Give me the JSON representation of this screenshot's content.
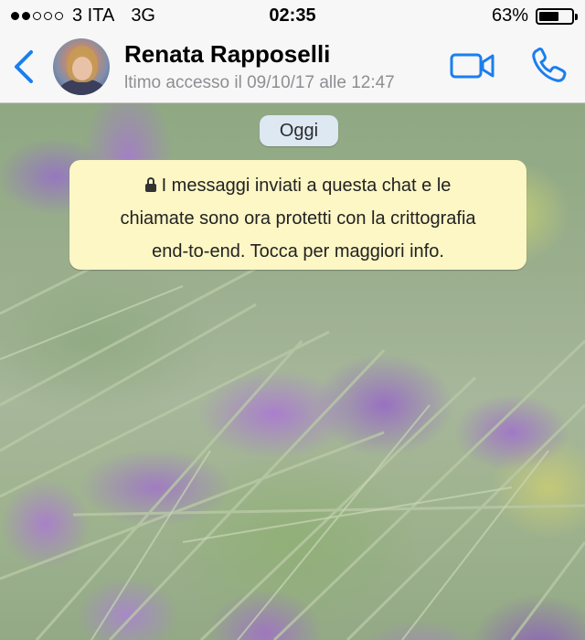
{
  "status_bar": {
    "carrier": "3 ITA",
    "network": "3G",
    "time": "02:35",
    "battery_percent_label": "63%",
    "battery_level": 0.63,
    "signal_bars_filled": 2,
    "signal_bars_total": 5
  },
  "header": {
    "back_icon": "chevron-left-icon",
    "contact_name": "Renata Rapposelli",
    "last_seen": "ltimo accesso il 09/10/17 alle 12:47",
    "video_icon": "video-camera-icon",
    "call_icon": "phone-icon",
    "accent_color": "#1a7ef0"
  },
  "chat": {
    "date_label": "Oggi",
    "encryption_notice": {
      "icon": "lock-icon",
      "line1": "I messaggi inviati a questa chat e le",
      "line2": "chiamate sono ora protetti con la crittografia",
      "line3": "end-to-end. Tocca per maggiori info."
    },
    "notice_bg": "#fdf6c5",
    "date_pill_bg": "#dde8f3"
  }
}
